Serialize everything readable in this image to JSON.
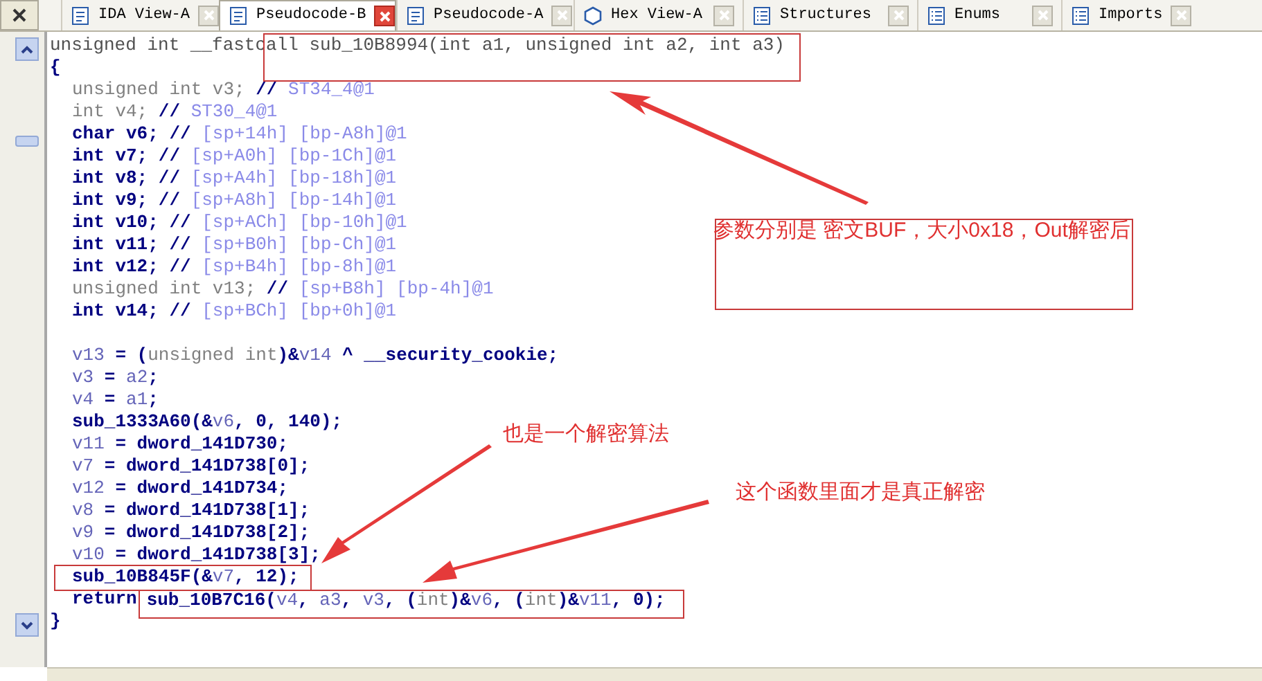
{
  "tabs": [
    {
      "label": "IDA View-A",
      "kind": "document",
      "selected": false
    },
    {
      "label": "Pseudocode-B",
      "kind": "document",
      "selected": true
    },
    {
      "label": "Pseudocode-A",
      "kind": "document",
      "selected": false
    },
    {
      "label": "Hex View-A",
      "kind": "hex",
      "selected": false
    },
    {
      "label": "Structures",
      "kind": "list",
      "selected": false
    },
    {
      "label": "Enums",
      "kind": "list",
      "selected": false
    },
    {
      "label": "Imports",
      "kind": "list",
      "selected": false
    }
  ],
  "code": {
    "signature": "unsigned int __fastcall sub_10B8994(int a1, unsigned int a2, int a3)",
    "open": "{",
    "declarations": [
      [
        {
          "text": "unsigned int v3;",
          "kind": "type"
        },
        {
          "text": " //",
          "kind": "ident"
        },
        {
          "text": " ST34_4@1",
          "kind": "comment"
        }
      ],
      [
        {
          "text": "int v4;",
          "kind": "type"
        },
        {
          "text": " //",
          "kind": "ident"
        },
        {
          "text": " ST30_4@1",
          "kind": "comment"
        }
      ],
      [
        {
          "text": "char v6; //",
          "kind": "ident"
        },
        {
          "text": " [sp+14h] [bp-A8h]@1",
          "kind": "comment"
        }
      ],
      [
        {
          "text": "int v7; //",
          "kind": "ident"
        },
        {
          "text": " [sp+A0h] [bp-1Ch]@1",
          "kind": "comment"
        }
      ],
      [
        {
          "text": "int v8; //",
          "kind": "ident"
        },
        {
          "text": " [sp+A4h] [bp-18h]@1",
          "kind": "comment"
        }
      ],
      [
        {
          "text": "int v9; //",
          "kind": "ident"
        },
        {
          "text": " [sp+A8h] [bp-14h]@1",
          "kind": "comment"
        }
      ],
      [
        {
          "text": "int v10; //",
          "kind": "ident"
        },
        {
          "text": " [sp+ACh] [bp-10h]@1",
          "kind": "comment"
        }
      ],
      [
        {
          "text": "int v11; //",
          "kind": "ident"
        },
        {
          "text": " [sp+B0h] [bp-Ch]@1",
          "kind": "comment"
        }
      ],
      [
        {
          "text": "int v12; //",
          "kind": "ident"
        },
        {
          "text": " [sp+B4h] [bp-8h]@1",
          "kind": "comment"
        }
      ],
      [
        {
          "text": "unsigned int v13;",
          "kind": "type"
        },
        {
          "text": " //",
          "kind": "ident"
        },
        {
          "text": " [sp+B8h] [bp-4h]@1",
          "kind": "comment"
        }
      ],
      [
        {
          "text": "int v14; //",
          "kind": "ident"
        },
        {
          "text": " [sp+BCh] [bp+0h]@1",
          "kind": "comment"
        }
      ]
    ],
    "statements": [
      [
        {
          "text": "v13",
          "kind": "var"
        },
        {
          "text": " = (",
          "kind": "ident"
        },
        {
          "text": "unsigned int",
          "kind": "type"
        },
        {
          "text": ")&",
          "kind": "ident"
        },
        {
          "text": "v14",
          "kind": "var"
        },
        {
          "text": " ^ __security_cookie;",
          "kind": "ident"
        }
      ],
      [
        {
          "text": "v3",
          "kind": "var"
        },
        {
          "text": " = ",
          "kind": "ident"
        },
        {
          "text": "a2",
          "kind": "var"
        },
        {
          "text": ";",
          "kind": "ident"
        }
      ],
      [
        {
          "text": "v4",
          "kind": "var"
        },
        {
          "text": " = ",
          "kind": "ident"
        },
        {
          "text": "a1",
          "kind": "var"
        },
        {
          "text": ";",
          "kind": "ident"
        }
      ],
      [
        {
          "text": "sub_1333A60(&",
          "kind": "ident"
        },
        {
          "text": "v6",
          "kind": "var"
        },
        {
          "text": ", 0, 140);",
          "kind": "ident"
        }
      ],
      [
        {
          "text": "v11",
          "kind": "var"
        },
        {
          "text": " = dword_141D730;",
          "kind": "ident"
        }
      ],
      [
        {
          "text": "v7",
          "kind": "var"
        },
        {
          "text": " = dword_141D738[0];",
          "kind": "ident"
        }
      ],
      [
        {
          "text": "v12",
          "kind": "var"
        },
        {
          "text": " = dword_141D734;",
          "kind": "ident"
        }
      ],
      [
        {
          "text": "v8",
          "kind": "var"
        },
        {
          "text": " = dword_141D738[1];",
          "kind": "ident"
        }
      ],
      [
        {
          "text": "v9",
          "kind": "var"
        },
        {
          "text": " = dword_141D738[2];",
          "kind": "ident"
        }
      ],
      [
        {
          "text": "v10",
          "kind": "var"
        },
        {
          "text": " = dword_141D738[3];",
          "kind": "ident"
        }
      ],
      [
        {
          "kind": "group",
          "framed": true,
          "tokens": [
            {
              "text": "sub_10B845F(&",
              "kind": "ident"
            },
            {
              "text": "v7",
              "kind": "var"
            },
            {
              "text": ", 12);",
              "kind": "ident"
            }
          ]
        }
      ],
      [
        {
          "text": "return",
          "kind": "ident"
        },
        {
          "kind": "group",
          "framed": true,
          "tokens": [
            {
              "text": "sub_10B7C16(",
              "kind": "ident"
            },
            {
              "text": "v4",
              "kind": "var"
            },
            {
              "text": ", ",
              "kind": "ident"
            },
            {
              "text": "a3",
              "kind": "var"
            },
            {
              "text": ", ",
              "kind": "ident"
            },
            {
              "text": "v3",
              "kind": "var"
            },
            {
              "text": ", (",
              "kind": "ident"
            },
            {
              "text": "int",
              "kind": "type"
            },
            {
              "text": ")&",
              "kind": "ident"
            },
            {
              "text": "v6",
              "kind": "var"
            },
            {
              "text": ", (",
              "kind": "ident"
            },
            {
              "text": "int",
              "kind": "type"
            },
            {
              "text": ")&",
              "kind": "ident"
            },
            {
              "text": "v11",
              "kind": "var"
            },
            {
              "text": ", 0);",
              "kind": "ident"
            }
          ]
        }
      ]
    ],
    "close": "}"
  },
  "annotations": [
    "参数分别是 密文BUF，大小0x18，Out解密后",
    "也是一个解密算法",
    "这个函数里面才是真正解密"
  ]
}
